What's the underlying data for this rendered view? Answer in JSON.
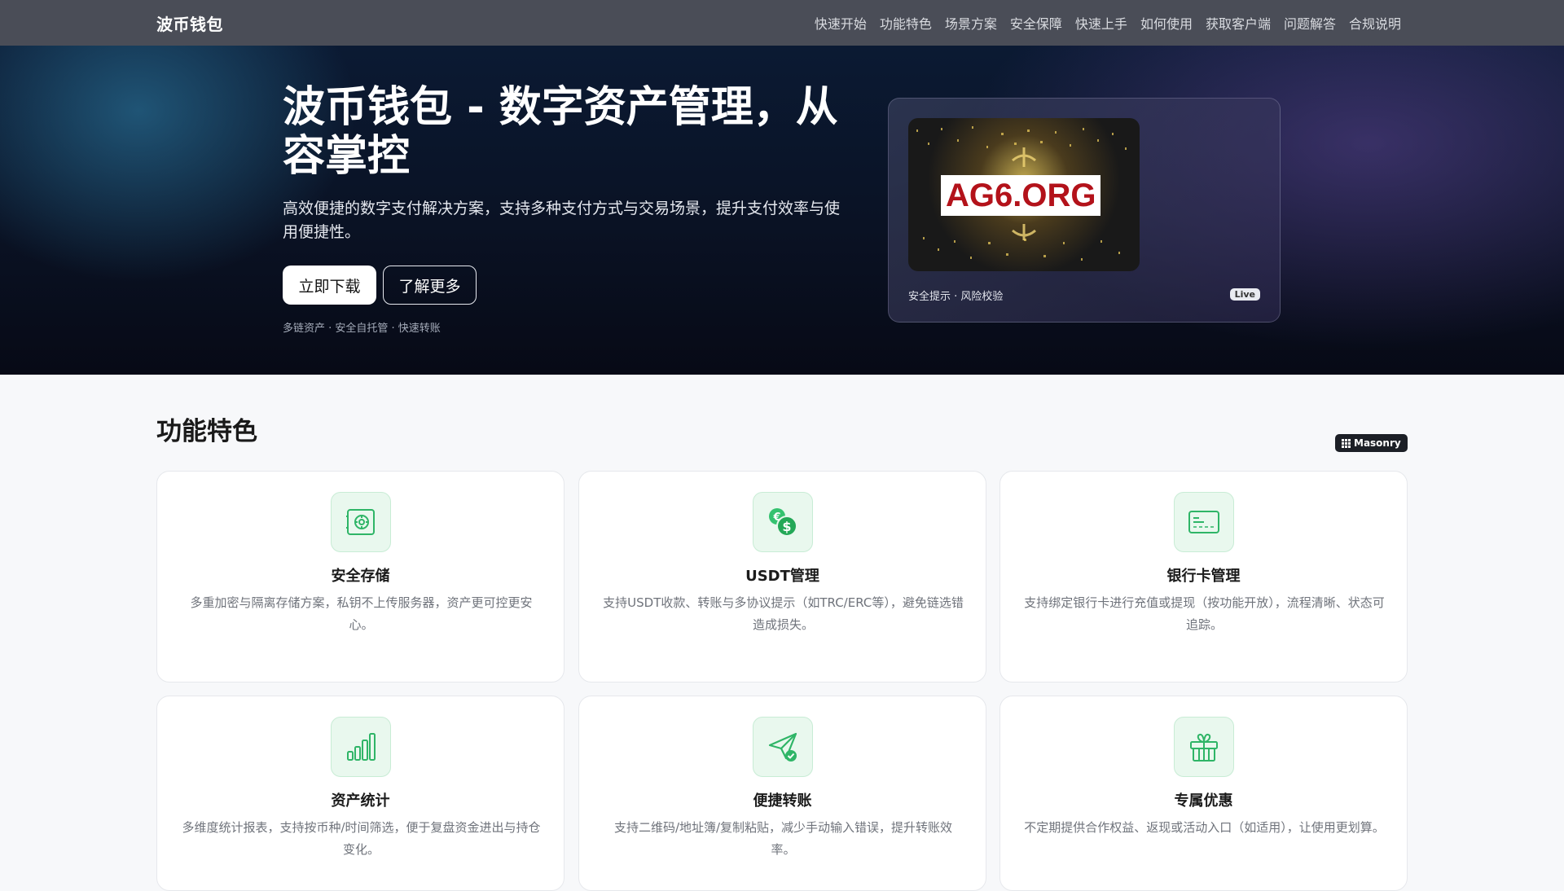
{
  "nav": {
    "brand": "波币钱包",
    "links": [
      "快速开始",
      "功能特色",
      "场景方案",
      "安全保障",
      "快速上手",
      "如何使用",
      "获取客户端",
      "问题解答",
      "合规说明"
    ]
  },
  "hero": {
    "title": "波币钱包 - 数字资产管理，从容掌控",
    "subtitle": "高效便捷的数字支付解决方案，支持多种支付方式与交易场景，提升支付效率与使用便捷性。",
    "primary_button": "立即下载",
    "secondary_button": "了解更多",
    "tags": "多链资产 · 安全自托管 · 快速转账",
    "card": {
      "image_label": "AG6.ORG",
      "caption": "安全提示 · 风险校验",
      "badge": "Live"
    }
  },
  "features": {
    "title": "功能特色",
    "badge": "Masonry",
    "items": [
      {
        "icon": "safe-icon",
        "title": "安全存储",
        "desc": "多重加密与隔离存储方案，私钥不上传服务器，资产更可控更安心。"
      },
      {
        "icon": "coins-icon",
        "title": "USDT管理",
        "desc": "支持USDT收款、转账与多协议提示（如TRC/ERC等），避免链选错造成损失。"
      },
      {
        "icon": "bank-card-icon",
        "title": "银行卡管理",
        "desc": "支持绑定银行卡进行充值或提现（按功能开放），流程清晰、状态可追踪。"
      },
      {
        "icon": "bar-chart-icon",
        "title": "资产统计",
        "desc": "多维度统计报表，支持按币种/时间筛选，便于复盘资金进出与持仓变化。"
      },
      {
        "icon": "send-icon",
        "title": "便捷转账",
        "desc": "支持二维码/地址簿/复制粘贴，减少手动输入错误，提升转账效率。"
      },
      {
        "icon": "gift-icon",
        "title": "专属优惠",
        "desc": "不定期提供合作权益、返现或活动入口（如适用），让使用更划算。"
      }
    ]
  }
}
